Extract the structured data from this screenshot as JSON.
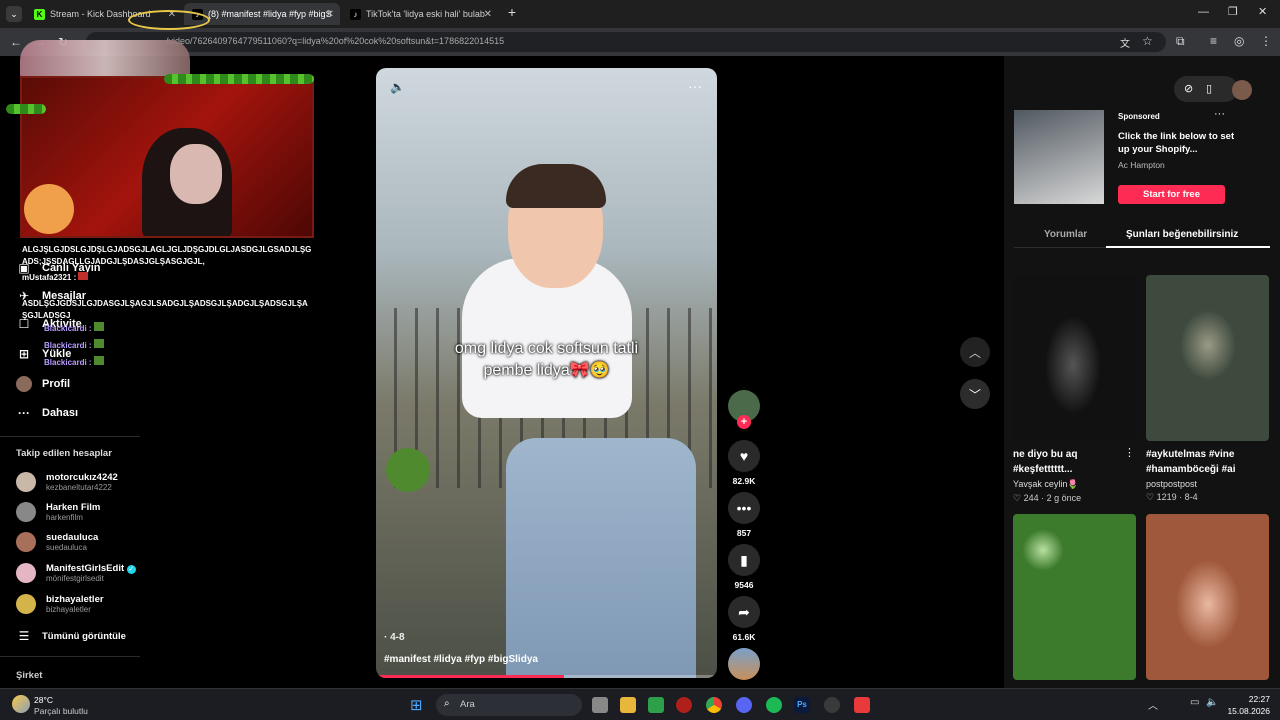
{
  "browser": {
    "tabs": [
      {
        "label": "Stream - Kick Dashboard",
        "icon": "kick-icon"
      },
      {
        "label": "(8) #manifest #lidya #fyp #bigS",
        "icon": "tiktok-icon"
      },
      {
        "label": "TikTok'ta 'lidya eski hali' bulab",
        "icon": "tiktok-icon"
      }
    ],
    "url": "/video/7626409764779511060?q=lidya%20of%20cok%20softsun&t=1786822014515"
  },
  "sidebar": {
    "nav": [
      {
        "label": "Canlı Yayın",
        "icon": "live-icon"
      },
      {
        "label": "Mesajlar",
        "icon": "message-icon"
      },
      {
        "label": "Aktivite",
        "icon": "activity-icon"
      },
      {
        "label": "Yükle",
        "icon": "upload-icon"
      },
      {
        "label": "Profil",
        "icon": "profile-icon"
      },
      {
        "label": "Dahası",
        "icon": "more-icon"
      }
    ],
    "following_title": "Takip edilen hesaplar",
    "following": [
      {
        "name": "motorcukız4242",
        "handle": "kezbaneltutar4222"
      },
      {
        "name": "Harken Film",
        "handle": "harkenfilm"
      },
      {
        "name": "suedauluca",
        "handle": "suedauluca"
      },
      {
        "name": "ManifestGirlsEdit",
        "handle": "mönifestgirlsedit"
      },
      {
        "name": "bizhayaletler",
        "handle": "bizhayaletler"
      }
    ],
    "see_all": "Tümünü görüntüle",
    "company": "Şirket"
  },
  "chat": {
    "lines": [
      "ALGJŞLGJDSLGJDŞLGJADSGJLAGLJGLJDŞGJDLGLJASDGJLGSADJLŞG",
      "ADS;JŞSDAGLLGJADGJLŞDASJGLŞASGJGJL,",
      "mUstafa2321 :",
      "ASDLŞGJGDSJLGJDASGJLŞAGJLSADGJLŞADSGJLŞADGJLŞADSGJLŞA",
      "ŞGJLADSGJ"
    ],
    "badge_lines": [
      "Blackicardi :",
      "Blackicardi :",
      "Blackicardi :"
    ]
  },
  "video": {
    "caption_line1": "omg lidya cok softsun tatli",
    "caption_line2": "pembe lidya🎀🥹",
    "timestamp": "4-8",
    "hashtags": "#manifest #lidya #fyp #bigSlidya",
    "progress": 0.55
  },
  "actions": {
    "likes": "82.9K",
    "comments": "857",
    "saves": "9546",
    "shares": "61.6K"
  },
  "ad": {
    "label": "Sponsored",
    "text": "Click the link below to set up your Shopify...",
    "author": "Ac Hampton",
    "cta": "Start for free"
  },
  "right_tabs": [
    "Yorumlar",
    "Şunları beğenebilirsiniz"
  ],
  "cards": [
    {
      "title": "ne diyo bu aq #keşfetttttt...",
      "user": "Yavşak ceylin🌷",
      "likes": "244",
      "age": "2 g önce"
    },
    {
      "title": "#aykutelmas #vine #hamamböceği #ai",
      "user": "postpostpost",
      "likes": "1219",
      "age": "8-4"
    },
    {
      "title": "",
      "user": "",
      "likes": "",
      "age": ""
    },
    {
      "title": "",
      "user": "",
      "likes": "",
      "age": ""
    }
  ],
  "taskbar": {
    "weather_temp": "28°C",
    "weather_desc": "Parçalı bulutlu",
    "search": "Ara",
    "time": "22:27",
    "date": "15.08.2026"
  },
  "colors": {
    "accent": "#fe2c55",
    "verified": "#20d5ec"
  }
}
